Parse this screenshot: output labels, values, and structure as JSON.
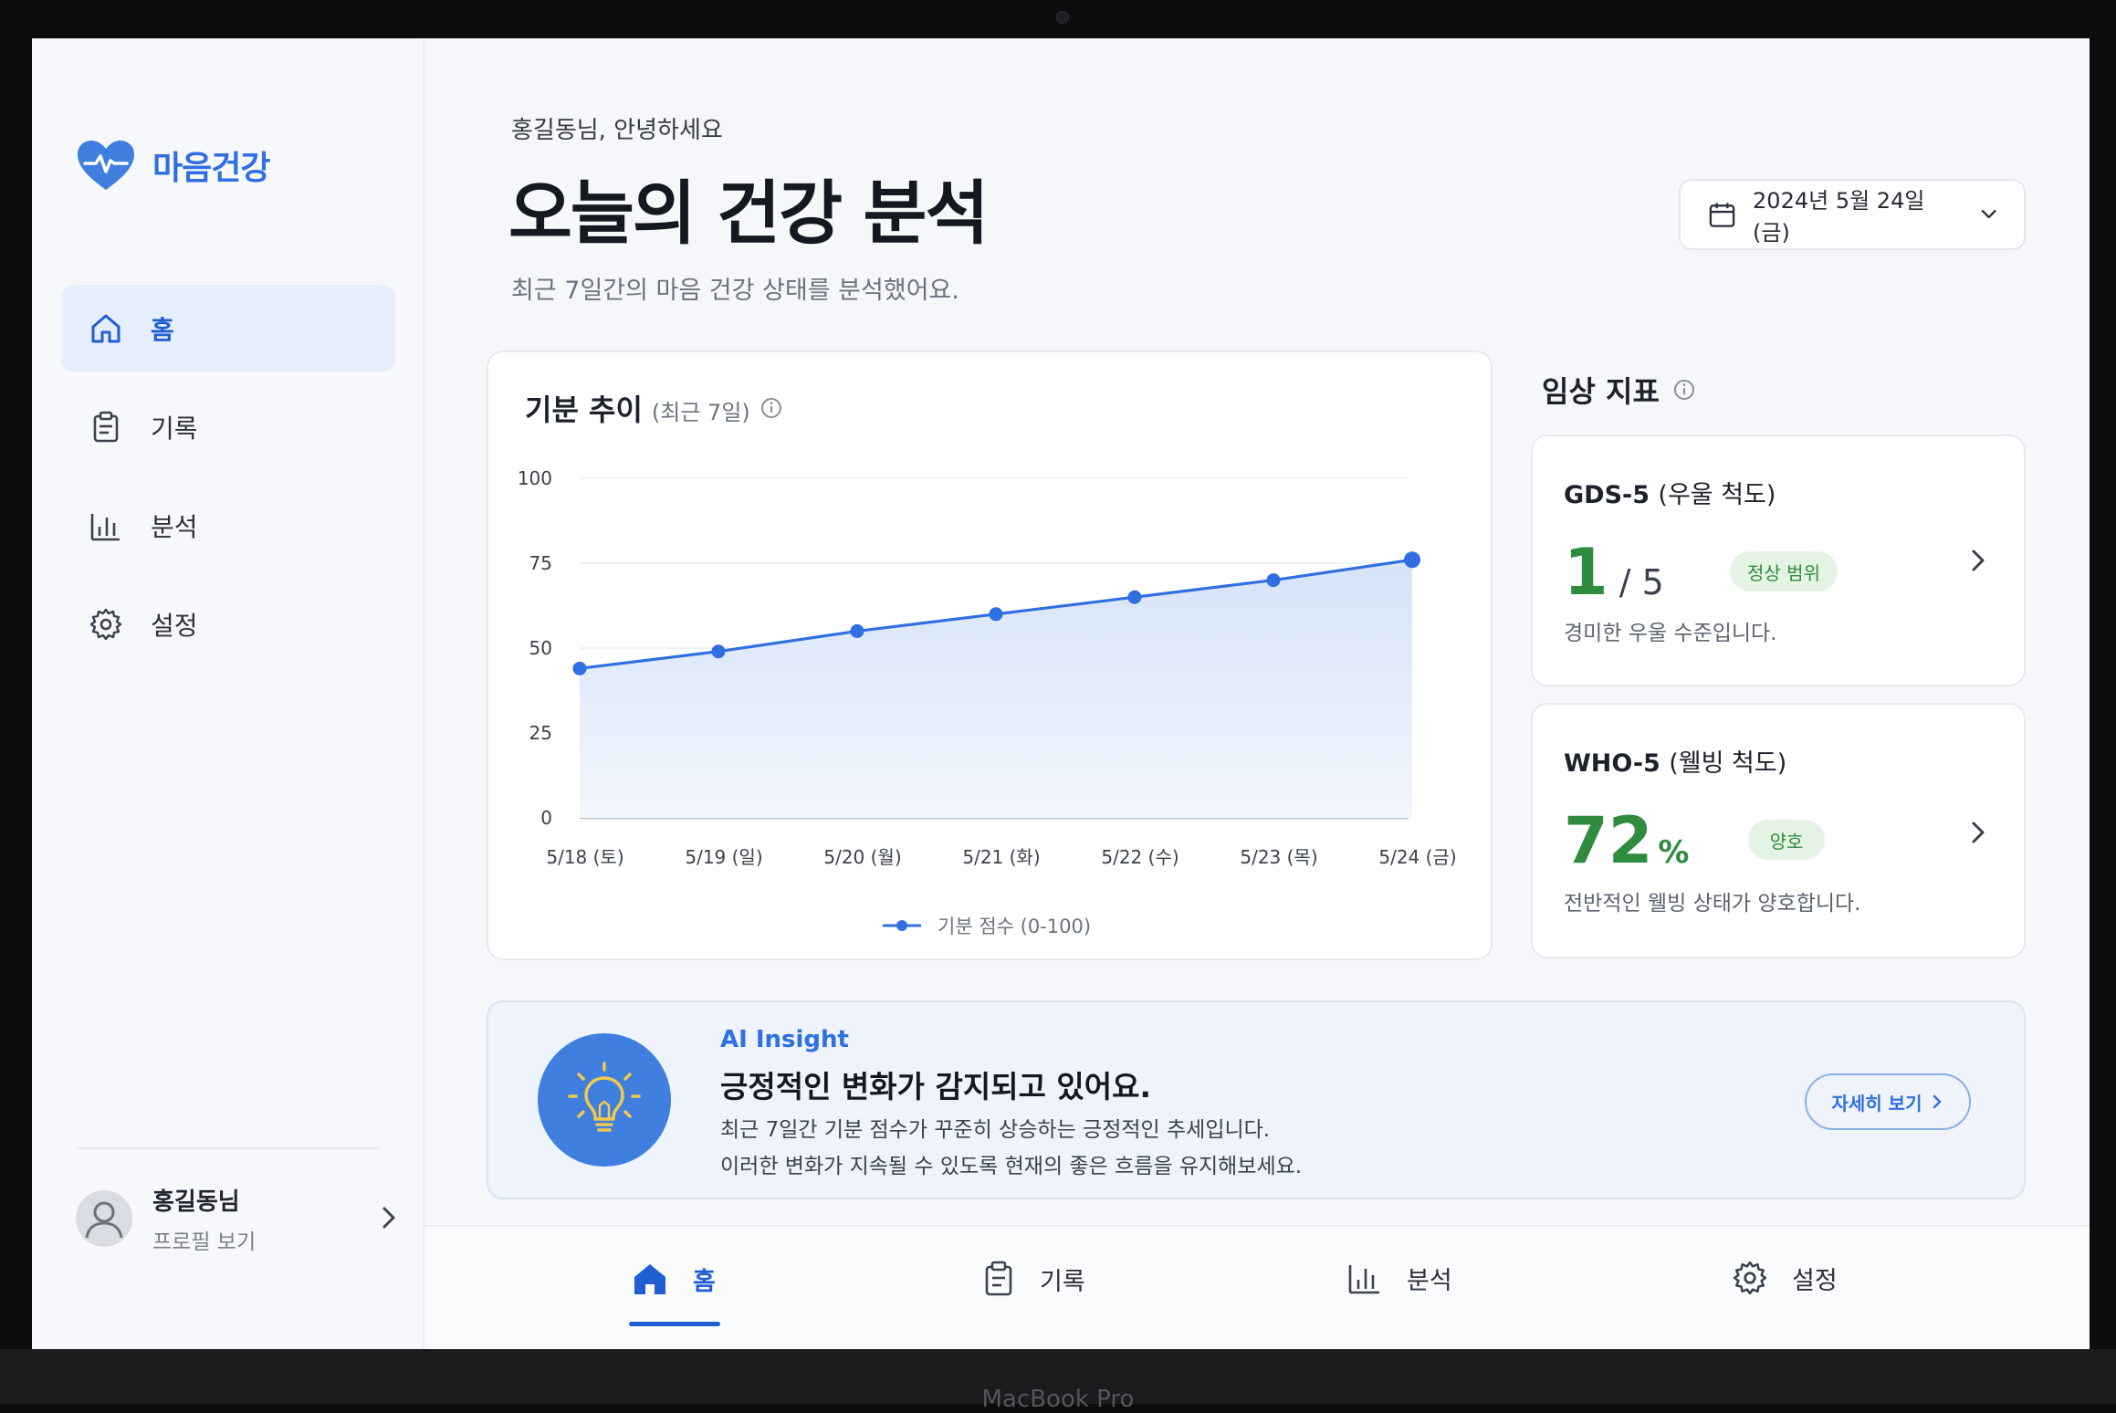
{
  "device": {
    "label": "MacBook Pro"
  },
  "app": {
    "name": "마음건강"
  },
  "sidebar": {
    "items": [
      {
        "label": "홈",
        "icon": "home-icon",
        "active": true
      },
      {
        "label": "기록",
        "icon": "clipboard-icon",
        "active": false
      },
      {
        "label": "분석",
        "icon": "bar-chart-icon",
        "active": false
      },
      {
        "label": "설정",
        "icon": "gear-icon",
        "active": false
      }
    ],
    "profile": {
      "name": "홍길동님",
      "link": "프로필 보기"
    }
  },
  "header": {
    "greeting": "홍길동님, 안녕하세요",
    "title": "오늘의 건강 분석",
    "subtitle": "최근 7일간의 마음 건강 상태를 분석했어요.",
    "date": "2024년 5월 24일 (금)"
  },
  "mood_card": {
    "title": "기분 추이",
    "period": "(최근 7일)"
  },
  "chart_data": {
    "type": "area",
    "title": "기분 추이 (최근 7일)",
    "categories": [
      "5/18 (토)",
      "5/19 (일)",
      "5/20 (월)",
      "5/21 (화)",
      "5/22 (수)",
      "5/23 (목)",
      "5/24 (금)"
    ],
    "series": [
      {
        "name": "기분 점수 (0-100)",
        "values": [
          44,
          49,
          55,
          60,
          65,
          70,
          76
        ],
        "color": "#2f6fe2"
      }
    ],
    "yticks": [
      0,
      25,
      50,
      75,
      100
    ],
    "ylim": [
      0,
      100
    ],
    "grid": true,
    "legend": "bottom"
  },
  "clinical": {
    "title": "임상 지표",
    "gds": {
      "name": "GDS-5",
      "name_paren": "(우울 척도)",
      "value": "1",
      "max": "/ 5",
      "badge": "정상 범위",
      "desc": "경미한 우울 수준입니다."
    },
    "who": {
      "name": "WHO-5",
      "name_paren": "(웰빙 척도)",
      "value": "72",
      "unit": "%",
      "badge": "양호",
      "desc": "전반적인 웰빙 상태가 양호합니다."
    }
  },
  "insight": {
    "tag": "AI Insight",
    "title": "긍정적인 변화가 감지되고 있어요.",
    "line1": "최근 7일간 기분 점수가 꾸준히 상승하는 긍정적인 추세입니다.",
    "line2": "이러한 변화가 지속될 수 있도록 현재의 좋은 흐름을 유지해보세요.",
    "button": "자세히 보기"
  },
  "bottom_nav": {
    "items": [
      {
        "label": "홈",
        "active": true
      },
      {
        "label": "기록",
        "active": false
      },
      {
        "label": "분석",
        "active": false
      },
      {
        "label": "설정",
        "active": false
      }
    ]
  },
  "colors": {
    "accent": "#2f6fe2",
    "positive": "#2f8c3f",
    "positive_bg": "#e4f3e4"
  }
}
